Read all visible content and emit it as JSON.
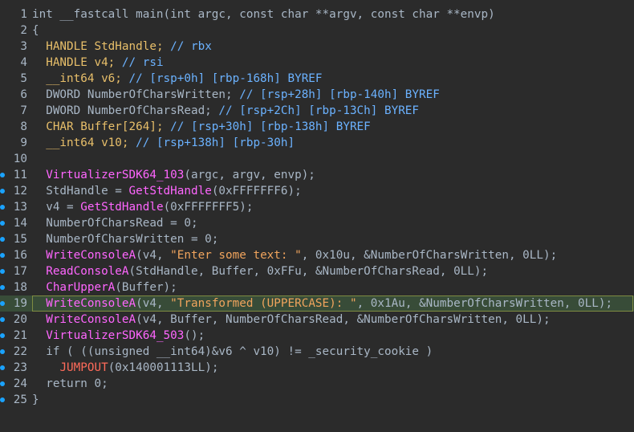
{
  "colors": {
    "background": "#2b2b2b",
    "text": "#a9b7c6",
    "type_keyword": "#e8bf6a",
    "comment": "#6bb2ff",
    "function_call": "#ff66ff",
    "string_literal": "#f0a45d",
    "jumpout": "#ff6b5a",
    "highlight_line": "#384c38",
    "breakpoint_dot": "#1aa3ff"
  },
  "highlighted_line": 19,
  "lines": [
    {
      "n": "1",
      "dot": false,
      "tokens": [
        [
          "int __fastcall main(int argc, const char **argv, const char **envp)",
          "plain"
        ]
      ]
    },
    {
      "n": "2",
      "dot": false,
      "tokens": [
        [
          "{",
          "plain"
        ]
      ]
    },
    {
      "n": "3",
      "dot": false,
      "tokens": [
        [
          "  ",
          "plain"
        ],
        [
          "HANDLE StdHandle;",
          "type"
        ],
        [
          " // rbx",
          "cmt"
        ]
      ]
    },
    {
      "n": "4",
      "dot": false,
      "tokens": [
        [
          "  ",
          "plain"
        ],
        [
          "HANDLE v4;",
          "type"
        ],
        [
          " // rsi",
          "cmt"
        ]
      ]
    },
    {
      "n": "5",
      "dot": false,
      "tokens": [
        [
          "  ",
          "plain"
        ],
        [
          "__int64 v6;",
          "type"
        ],
        [
          " // [rsp+0h] [rbp-168h] BYREF",
          "cmt"
        ]
      ]
    },
    {
      "n": "6",
      "dot": false,
      "tokens": [
        [
          "  DWORD NumberOfCharsWritten;",
          "plain"
        ],
        [
          " // [rsp+28h] [rbp-140h] BYREF",
          "cmt"
        ]
      ]
    },
    {
      "n": "7",
      "dot": false,
      "tokens": [
        [
          "  DWORD NumberOfCharsRead;",
          "plain"
        ],
        [
          " // [rsp+2Ch] [rbp-13Ch] BYREF",
          "cmt"
        ]
      ]
    },
    {
      "n": "8",
      "dot": false,
      "tokens": [
        [
          "  ",
          "plain"
        ],
        [
          "CHAR Buffer[264];",
          "type"
        ],
        [
          " // [rsp+30h] [rbp-138h] BYREF",
          "cmt"
        ]
      ]
    },
    {
      "n": "9",
      "dot": false,
      "tokens": [
        [
          "  ",
          "plain"
        ],
        [
          "__int64 v10;",
          "type"
        ],
        [
          " // [rsp+138h] [rbp-30h]",
          "cmt"
        ]
      ]
    },
    {
      "n": "10",
      "dot": false,
      "tokens": [
        [
          "",
          "plain"
        ]
      ]
    },
    {
      "n": "11",
      "dot": true,
      "tokens": [
        [
          "  ",
          "plain"
        ],
        [
          "VirtualizerSDK64_103",
          "func"
        ],
        [
          "(argc, argv, envp);",
          "plain"
        ]
      ]
    },
    {
      "n": "12",
      "dot": true,
      "tokens": [
        [
          "  StdHandle = ",
          "plain"
        ],
        [
          "GetStdHandle",
          "func"
        ],
        [
          "(0xFFFFFFF6);",
          "plain"
        ]
      ]
    },
    {
      "n": "13",
      "dot": true,
      "tokens": [
        [
          "  v4 = ",
          "plain"
        ],
        [
          "GetStdHandle",
          "func"
        ],
        [
          "(0xFFFFFFF5);",
          "plain"
        ]
      ]
    },
    {
      "n": "14",
      "dot": true,
      "tokens": [
        [
          "  NumberOfCharsRead = 0;",
          "plain"
        ]
      ]
    },
    {
      "n": "15",
      "dot": true,
      "tokens": [
        [
          "  NumberOfCharsWritten = 0;",
          "plain"
        ]
      ]
    },
    {
      "n": "16",
      "dot": true,
      "tokens": [
        [
          "  ",
          "plain"
        ],
        [
          "WriteConsoleA",
          "func"
        ],
        [
          "(v4, ",
          "plain"
        ],
        [
          "\"Enter some text: \"",
          "str"
        ],
        [
          ", 0x10u, &NumberOfCharsWritten, 0LL);",
          "plain"
        ]
      ]
    },
    {
      "n": "17",
      "dot": true,
      "tokens": [
        [
          "  ",
          "plain"
        ],
        [
          "ReadConsoleA",
          "func"
        ],
        [
          "(StdHandle, Buffer, 0xFFu, &NumberOfCharsRead, 0LL);",
          "plain"
        ]
      ]
    },
    {
      "n": "18",
      "dot": true,
      "tokens": [
        [
          "  ",
          "plain"
        ],
        [
          "CharUpperA",
          "func"
        ],
        [
          "(Buffer);",
          "plain"
        ]
      ]
    },
    {
      "n": "19",
      "dot": true,
      "tokens": [
        [
          "  ",
          "plain"
        ],
        [
          "WriteConsoleA",
          "func"
        ],
        [
          "(v4, ",
          "plain"
        ],
        [
          "\"Transformed (UPPERCASE): \"",
          "str"
        ],
        [
          ", 0x1Au, &NumberOfCharsWritten, 0LL);",
          "plain"
        ]
      ]
    },
    {
      "n": "20",
      "dot": true,
      "tokens": [
        [
          "  ",
          "plain"
        ],
        [
          "WriteConsoleA",
          "func"
        ],
        [
          "(v4, Buffer, NumberOfCharsRead, &NumberOfCharsWritten, 0LL);",
          "plain"
        ]
      ]
    },
    {
      "n": "21",
      "dot": true,
      "tokens": [
        [
          "  ",
          "plain"
        ],
        [
          "VirtualizerSDK64_503",
          "func"
        ],
        [
          "();",
          "plain"
        ]
      ]
    },
    {
      "n": "22",
      "dot": true,
      "tokens": [
        [
          "  if ( ((unsigned __int64)&v6 ^ v10) != _security_cookie )",
          "plain"
        ]
      ]
    },
    {
      "n": "23",
      "dot": true,
      "tokens": [
        [
          "    ",
          "plain"
        ],
        [
          "JUMPOUT",
          "jump"
        ],
        [
          "(0x140001113LL);",
          "plain"
        ]
      ]
    },
    {
      "n": "24",
      "dot": true,
      "tokens": [
        [
          "  return 0;",
          "plain"
        ]
      ]
    },
    {
      "n": "25",
      "dot": true,
      "tokens": [
        [
          "}",
          "plain"
        ]
      ]
    }
  ]
}
